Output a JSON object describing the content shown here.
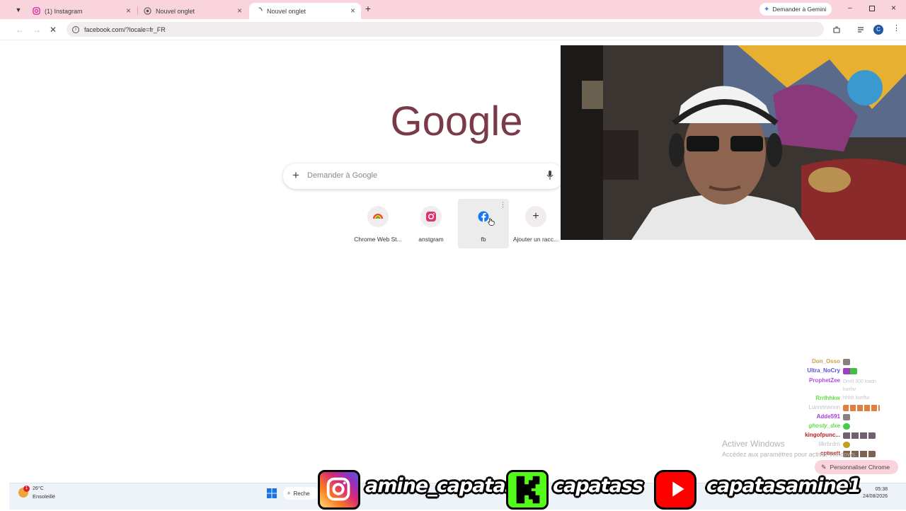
{
  "browser": {
    "tabs": [
      {
        "label": "(1) Instagram",
        "active": false
      },
      {
        "label": "Nouvel onglet",
        "active": false
      },
      {
        "label": "Nouvel onglet",
        "active": true
      }
    ],
    "new_tab_symbol": "+",
    "gemini_label": "Demander à Gemini",
    "url": "facebook.com/?locale=fr_FR",
    "profile_initial": "C"
  },
  "newtab": {
    "logo_text": "Google",
    "search_placeholder": "Demander à Google",
    "shortcuts": [
      {
        "label": "Chrome Web St...",
        "icon": "rainbow-icon"
      },
      {
        "label": "anstgram",
        "icon": "instagram-icon"
      },
      {
        "label": "fb",
        "icon": "facebook-icon"
      },
      {
        "label": "Ajouter un racc...",
        "icon": "plus-icon"
      }
    ],
    "customize_label": "Personnaliser Chrome"
  },
  "chat": [
    {
      "user": "Don_Osso",
      "color": "#c8a24a",
      "message": ""
    },
    {
      "user": "Ultra_NoCry",
      "color": "#5a56d8",
      "message": ""
    },
    {
      "user": "ProphetZee",
      "color": "#b04be0",
      "message": "Drrrll 300 kwdn kwrfw"
    },
    {
      "user": "Rrrlhhkw",
      "color": "#66dd44",
      "message": "hhhh kwrffw"
    },
    {
      "user": "Lunnnnnnnn",
      "color": "#c0c0c0",
      "message": ""
    },
    {
      "user": "Adde591",
      "color": "#a83ae0",
      "message": ""
    },
    {
      "user": "ghosty_dxe",
      "color": "#66dd44",
      "message": ""
    },
    {
      "user": "kingofpunc...",
      "color": "#b82020",
      "message": ""
    },
    {
      "user": "lilkrbrdrn",
      "color": "#c0c0c0",
      "message": ""
    },
    {
      "user": "cptwett",
      "color": "#b82020",
      "message": ""
    }
  ],
  "windows_activation": {
    "title": "Activer Windows",
    "subtitle": "Accédez aux paramètres pour activer Windows."
  },
  "taskbar": {
    "weather_temp": "26°C",
    "weather_condition": "Ensoleillé",
    "weather_badge": "1",
    "search_text": "Reche",
    "time": "05:38",
    "date": "24/08/2026"
  },
  "overlay": {
    "instagram_handle": "amine_capatas",
    "kick_handle": "capatass",
    "youtube_handle": "capatasamine1"
  },
  "colors": {
    "tab_strip": "#f9d4dc",
    "google_logo": "#7b3a4a",
    "instagram": "#e1306c",
    "kick": "#53fc18",
    "youtube": "#ff0000"
  }
}
